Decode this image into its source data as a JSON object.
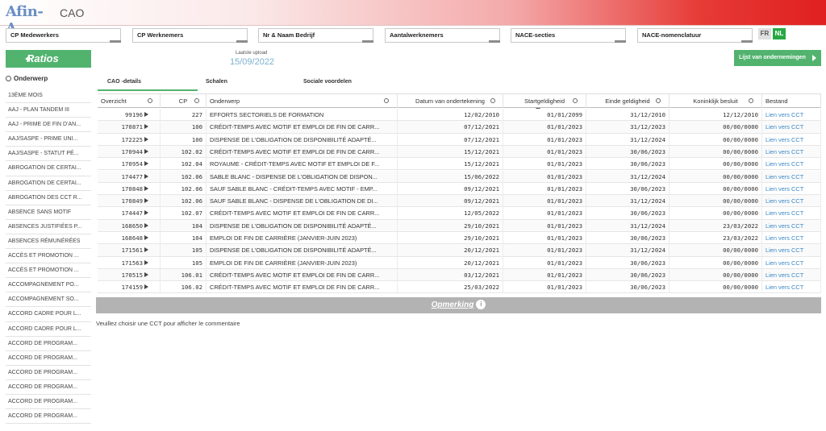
{
  "header": {
    "logo_text": "Afin-A",
    "app_title": "CAO"
  },
  "filters": [
    "CP Medewerkers",
    "CP Werknemers",
    "Nr & Naam Bedrijf",
    "Aantalwerknemers",
    "NACE-secties",
    "NACE-nomenclatuur"
  ],
  "lang": {
    "fr": "FR",
    "nl": "NL"
  },
  "ratios_label": "Ratios",
  "upload": {
    "label": "Laatste upload",
    "date": "15/09/2022"
  },
  "lijst_button": "Lijst van ondernemingen",
  "sidebar": {
    "title": "Onderwerp",
    "items": [
      "13ÈME MOIS",
      "AAJ - PLAN TANDEM III",
      "AAJ - PRIME DE FIN D'AN...",
      "AAJ/SASPE - PRIME UNI...",
      "AAJ/SASPE - STATUT PÉ...",
      "ABROGATION DE CERTAI...",
      "ABROGATION DE CERTAI...",
      "ABROGATION DES CCT R...",
      "ABSENCE SANS MOTIF",
      "ABSENCES JUSTIFIÉES P...",
      "ABSENCES RÉMUNÉRÉES",
      "ACCÈS ET PROMOTION ...",
      "ACCÈS ET PROMOTION ...",
      "ACCOMPAGNEMENT PO...",
      "ACCOMPAGNEMENT SO...",
      "ACCORD CADRE POUR L...",
      "ACCORD CADRE POUR L...",
      "ACCORD DE PROGRAM...",
      "ACCORD DE PROGRAM...",
      "ACCORD DE PROGRAM...",
      "ACCORD DE PROGRAM...",
      "ACCORD DE PROGRAM...",
      "ACCORD DE PROGRAM..."
    ]
  },
  "tabs": [
    "CAO -details",
    "Schalen",
    "Sociale voordelen"
  ],
  "table": {
    "columns": [
      "Overzicht",
      "CP",
      "Onderwerp",
      "Datum van ondertekening",
      "Startgeldigheid",
      "Einde geldigheid",
      "Koninklijk besluit",
      "Bestand"
    ],
    "rows": [
      [
        "99196",
        "227",
        "EFFORTS SECTORIELS DE FORMATION",
        "12/02/2010",
        "01/01/2099",
        "31/12/2010",
        "12/12/2010",
        "Lien vers CCT"
      ],
      [
        "170871",
        "100",
        "CRÉDIT-TEMPS AVEC MOTIF ET EMPLOI DE FIN DE CARR...",
        "07/12/2021",
        "01/01/2023",
        "31/12/2023",
        "00/00/0000",
        "Lien vers CCT"
      ],
      [
        "172225",
        "100",
        "DISPENSE DE L'OBLIGATION DE DISPONIBILITÉ ADAPTÉ...",
        "07/12/2021",
        "01/01/2023",
        "31/12/2024",
        "00/00/0000",
        "Lien vers CCT"
      ],
      [
        "170944",
        "102.02",
        "CRÉDIT-TEMPS AVEC MOTIF ET EMPLOI DE FIN DE CARR...",
        "15/12/2021",
        "01/01/2023",
        "30/06/2023",
        "00/00/0000",
        "Lien vers CCT"
      ],
      [
        "170954",
        "102.04",
        "ROYAUME - CRÉDIT-TEMPS AVEC MOTIF ET EMPLOI DE F...",
        "15/12/2021",
        "01/01/2023",
        "30/06/2023",
        "00/00/0000",
        "Lien vers CCT"
      ],
      [
        "174477",
        "102.06",
        "SABLE BLANC - DISPENSE DE L'OBLIGATION DE DISPON...",
        "15/06/2022",
        "01/01/2023",
        "31/12/2024",
        "00/00/0000",
        "Lien vers CCT"
      ],
      [
        "170848",
        "102.06",
        "SAUF SABLE BLANC - CRÉDIT-TEMPS AVEC MOTIF - EMP...",
        "09/12/2021",
        "01/01/2023",
        "30/06/2023",
        "00/00/0000",
        "Lien vers CCT"
      ],
      [
        "170849",
        "102.06",
        "SAUF SABLE BLANC - DISPENSE DE L'OBLIGATION DE DI...",
        "09/12/2021",
        "01/01/2023",
        "31/12/2024",
        "00/00/0000",
        "Lien vers CCT"
      ],
      [
        "174447",
        "102.07",
        "CRÉDIT-TEMPS AVEC MOTIF ET EMPLOI DE FIN DE CARR...",
        "12/05/2022",
        "01/01/2023",
        "30/06/2023",
        "00/00/0000",
        "Lien vers CCT"
      ],
      [
        "168650",
        "104",
        "DISPENSE DE L'OBLIGATION DE DISPONIBILITÉ ADAPTÉ...",
        "29/10/2021",
        "01/01/2023",
        "31/12/2024",
        "23/03/2022",
        "Lien vers CCT"
      ],
      [
        "168648",
        "104",
        "EMPLOI DE FIN DE CARRIÈRE (JANVIER-JUIN 2023)",
        "29/10/2021",
        "01/01/2023",
        "30/06/2023",
        "23/03/2022",
        "Lien vers CCT"
      ],
      [
        "171561",
        "105",
        "DISPENSE DE L'OBLIGATION DE DISPONIBILITÉ ADAPTÉ...",
        "20/12/2021",
        "01/01/2023",
        "31/12/2024",
        "00/00/0000",
        "Lien vers CCT"
      ],
      [
        "171563",
        "105",
        "EMPLOI DE FIN DE CARRIÈRE (JANVIER-JUIN 2023)",
        "20/12/2021",
        "01/01/2023",
        "30/06/2023",
        "00/00/0000",
        "Lien vers CCT"
      ],
      [
        "170515",
        "106.01",
        "CRÉDIT-TEMPS AVEC MOTIF ET EMPLOI DE FIN DE CARR...",
        "03/12/2021",
        "01/01/2023",
        "30/06/2023",
        "00/00/0000",
        "Lien vers CCT"
      ],
      [
        "174159",
        "106.02",
        "CRÉDIT-TEMPS AVEC MOTIF ET EMPLOI DE FIN DE CARR...",
        "25/03/2022",
        "01/01/2023",
        "30/06/2023",
        "00/00/0000",
        "Lien vers CCT"
      ]
    ]
  },
  "opmerking": "Opmerking",
  "note": "Veuillez choisir une CCT pour afficher le commentaire",
  "colors": {
    "accent": "#52b36f",
    "link": "#3a88c7",
    "header_red": "#e02020"
  }
}
